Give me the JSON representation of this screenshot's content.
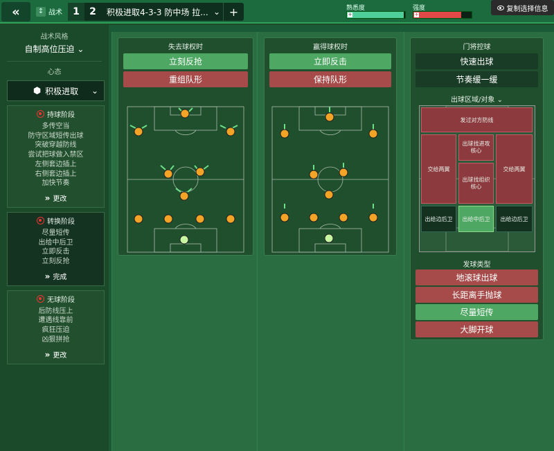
{
  "topbar": {
    "tab_label": "战术",
    "slot1": "1",
    "slot2": "2",
    "tactic_name": "积极进取4-3-3 防中场 拉...",
    "add_label": "+",
    "familiarity_label": "熟悉度",
    "familiarity_fill": 0.98,
    "intensity_label": "强度",
    "intensity_fill": 0.82,
    "copy_button_label": "复制选择信息",
    "colors": {
      "familiarity": "#4fcf9a",
      "intensity": "#e14848"
    }
  },
  "sidebar": {
    "style_heading": "战术风格",
    "style_value": "自制高位压迫",
    "mentality_heading": "心态",
    "mentality_value": "积极进取",
    "phases": [
      {
        "title": "持球阶段",
        "items": [
          "多传空当",
          "防守区域短传出球",
          "突破穿越防线",
          "尝试把球做入禁区",
          "左侧套边插上",
          "右侧套边插上",
          "加快节奏"
        ],
        "button": "更改"
      },
      {
        "title": "转换阶段",
        "items": [
          "尽量短传",
          "出给中后卫",
          "立即反击",
          "立刻反抢"
        ],
        "button": "完成"
      },
      {
        "title": "无球阶段",
        "items": [
          "后防线压上",
          "遭遇线靠前",
          "疯狂压迫",
          "凶狠拼抢"
        ],
        "button": "更改"
      }
    ]
  },
  "panels": {
    "loss": {
      "title": "失去球权时",
      "buttons": [
        {
          "label": "立刻反抢",
          "state": "green"
        },
        {
          "label": "重组队形",
          "state": "red"
        }
      ]
    },
    "gain": {
      "title": "赢得球权时",
      "buttons": [
        {
          "label": "立即反击",
          "state": "green"
        },
        {
          "label": "保持队形",
          "state": "red"
        }
      ]
    },
    "gk": {
      "title": "门将控球",
      "buttons": [
        {
          "label": "快速出球",
          "state": "dark"
        },
        {
          "label": "节奏缓一缓",
          "state": "dark"
        }
      ],
      "zone_heading": "出球区域/对象",
      "zones": {
        "top": "发过对方防线",
        "left_wide": "交给两翼",
        "right_wide": "交给两翼",
        "center_top": "出球找进攻核心",
        "center_bottom": "出球找组织核心",
        "bottom_left": "出给边后卫",
        "bottom_center": "出给中后卫",
        "bottom_right": "出给边后卫"
      },
      "distribution_heading": "发球类型",
      "distribution": [
        {
          "label": "地滚球出球",
          "state": "red"
        },
        {
          "label": "长距离手抛球",
          "state": "red"
        },
        {
          "label": "尽量短传",
          "state": "green"
        },
        {
          "label": "大脚开球",
          "state": "red"
        }
      ]
    }
  }
}
